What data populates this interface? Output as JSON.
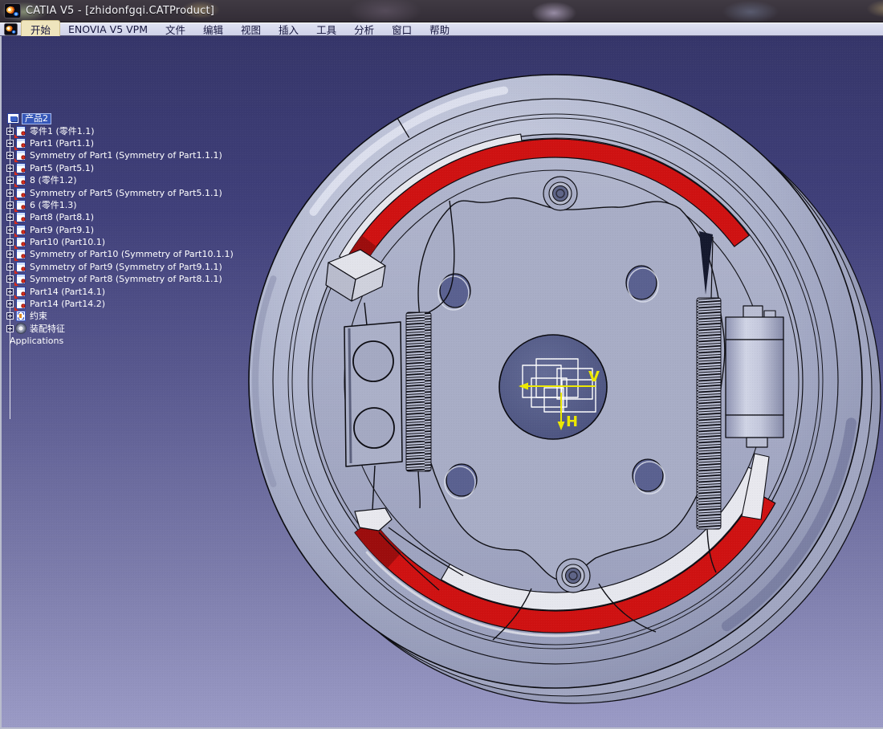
{
  "window": {
    "title": "CATIA V5 - [zhidonfgqi.CATProduct]",
    "app_icon": "catia-logo"
  },
  "menu_bar": {
    "items": [
      {
        "label": "开始",
        "highlighted": true
      },
      {
        "label": "ENOVIA V5 VPM",
        "highlighted": false
      },
      {
        "label": "文件",
        "highlighted": false
      },
      {
        "label": "编辑",
        "highlighted": false
      },
      {
        "label": "视图",
        "highlighted": false
      },
      {
        "label": "插入",
        "highlighted": false
      },
      {
        "label": "工具",
        "highlighted": false
      },
      {
        "label": "分析",
        "highlighted": false
      },
      {
        "label": "窗口",
        "highlighted": false
      },
      {
        "label": "帮助",
        "highlighted": false
      }
    ]
  },
  "tree": {
    "root": {
      "label": "产品2",
      "selected": true
    },
    "items": [
      {
        "label": "零件1 (零件1.1)",
        "type": "part",
        "expandable": true
      },
      {
        "label": "Part1 (Part1.1)",
        "type": "part",
        "expandable": true
      },
      {
        "label": "Symmetry of Part1 (Symmetry of Part1.1.1)",
        "type": "part",
        "expandable": true
      },
      {
        "label": "Part5 (Part5.1)",
        "type": "part",
        "expandable": true
      },
      {
        "label": "8 (零件1.2)",
        "type": "part",
        "expandable": true
      },
      {
        "label": "Symmetry of Part5 (Symmetry of Part5.1.1)",
        "type": "part",
        "expandable": true
      },
      {
        "label": "6 (零件1.3)",
        "type": "part",
        "expandable": true
      },
      {
        "label": "Part8 (Part8.1)",
        "type": "part",
        "expandable": true
      },
      {
        "label": "Part9 (Part9.1)",
        "type": "part",
        "expandable": true
      },
      {
        "label": "Part10 (Part10.1)",
        "type": "part",
        "expandable": true
      },
      {
        "label": "Symmetry of Part10 (Symmetry of Part10.1.1)",
        "type": "part",
        "expandable": true
      },
      {
        "label": "Symmetry of Part9 (Symmetry of Part9.1.1)",
        "type": "part",
        "expandable": true
      },
      {
        "label": "Symmetry of Part8 (Symmetry of Part8.1.1)",
        "type": "part",
        "expandable": true
      },
      {
        "label": "Part14 (Part14.1)",
        "type": "part",
        "expandable": true
      },
      {
        "label": "Part14 (Part14.2)",
        "type": "part",
        "expandable": true
      },
      {
        "label": "约束",
        "type": "constraints",
        "expandable": true
      },
      {
        "label": "装配特征",
        "type": "assembly-features",
        "expandable": true
      },
      {
        "label": "Applications",
        "type": "applications",
        "expandable": false
      }
    ]
  },
  "viewport": {
    "axis_marker": {
      "v_label": "V",
      "h_label": "H"
    },
    "model": {
      "name": "drum-brake-assembly",
      "colors": {
        "background_top": "#36366a",
        "background_bottom": "#9b9bc6",
        "drum_metal": "#a9aec8",
        "brake_lining_red": "#cf1212",
        "shoe_rim_white": "#e6e7ee",
        "hole_dark": "#5a6190",
        "axis_yellow": "#ece800"
      }
    }
  }
}
